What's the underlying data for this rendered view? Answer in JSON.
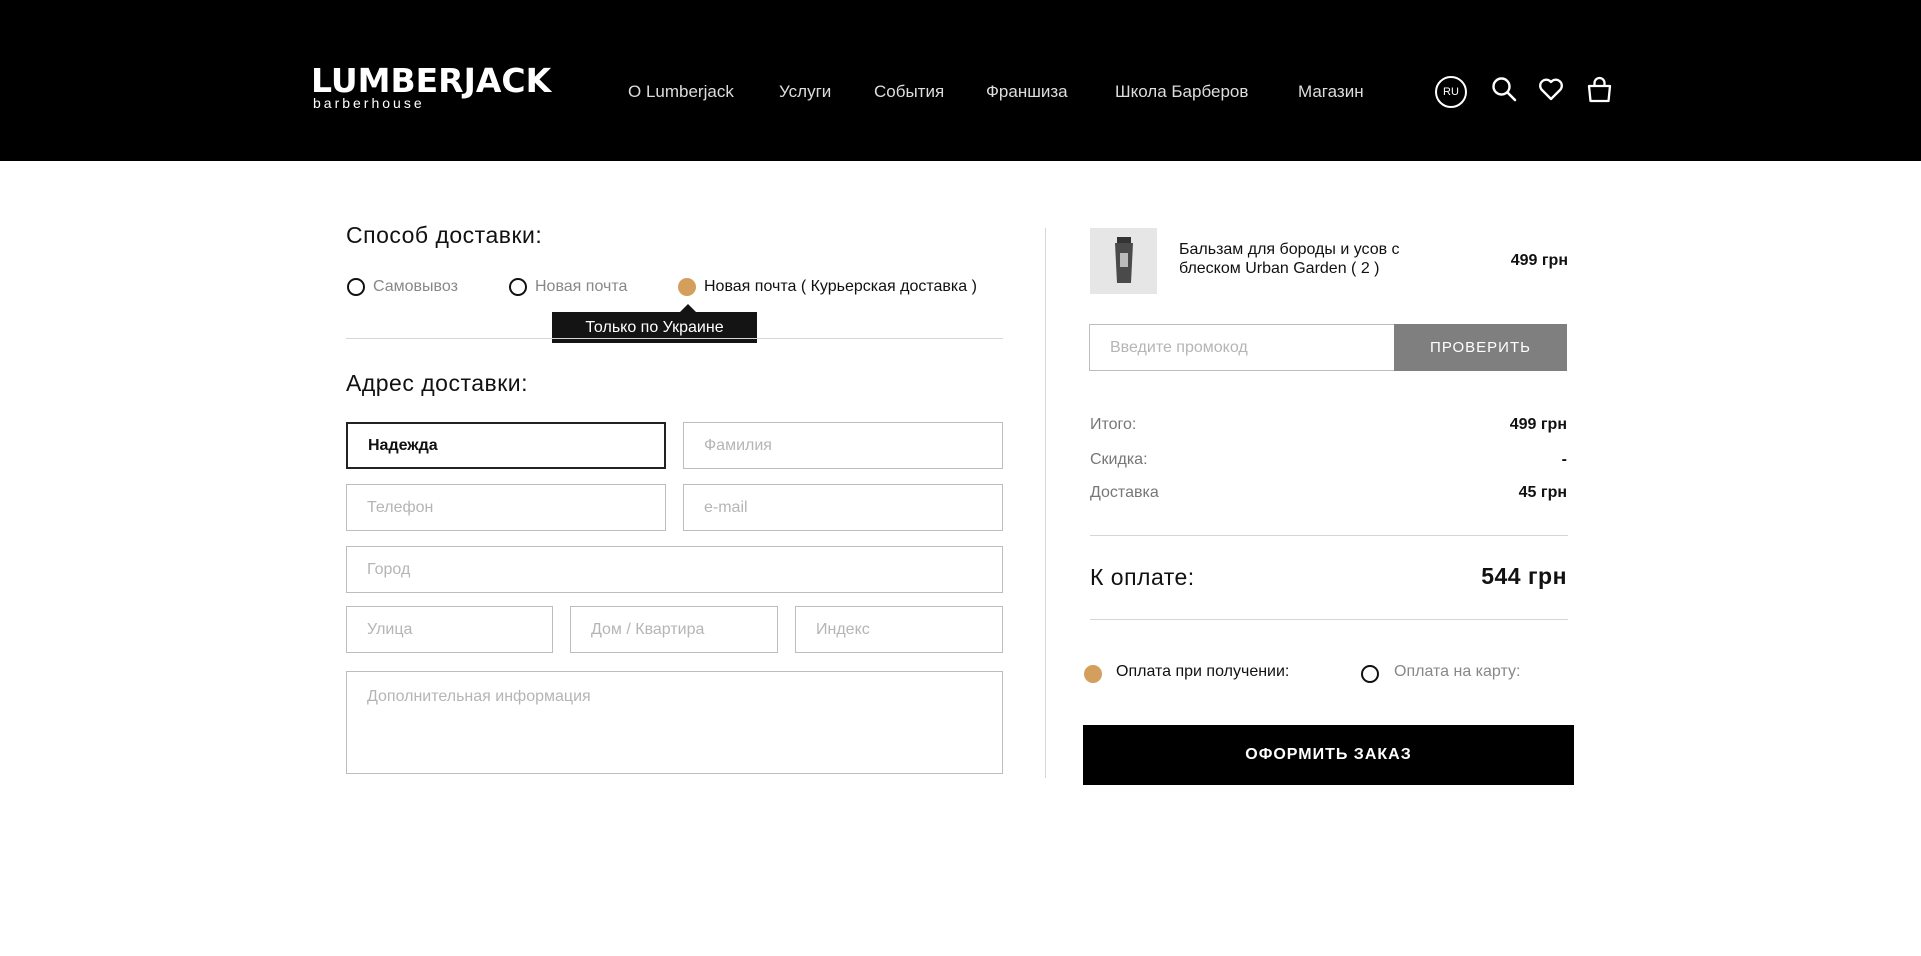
{
  "header": {
    "logo_main": "LUMBERJACK",
    "logo_sub": "barberhouse",
    "nav": [
      {
        "label": "О Lumberjack"
      },
      {
        "label": "Услуги"
      },
      {
        "label": "События"
      },
      {
        "label": "Франшиза"
      },
      {
        "label": "Школа Барберов"
      },
      {
        "label": "Магазин"
      }
    ],
    "lang": "RU",
    "icons": [
      "search-icon",
      "heart-icon",
      "cart-icon"
    ]
  },
  "delivery": {
    "title": "Способ доставки:",
    "options": [
      {
        "label": "Самовывоз",
        "selected": false
      },
      {
        "label": "Новая почта",
        "selected": false
      },
      {
        "label": "Новая почта ( Курьерская доставка )",
        "selected": true
      }
    ],
    "tooltip": "Только по Украине"
  },
  "address": {
    "title": "Адрес доставки:",
    "first_name": {
      "value": "Надежда",
      "placeholder": ""
    },
    "last_name": {
      "value": "",
      "placeholder": "Фамилия"
    },
    "phone": {
      "value": "",
      "placeholder": "Телефон"
    },
    "email": {
      "value": "",
      "placeholder": "e-mail"
    },
    "city": {
      "value": "",
      "placeholder": "Город"
    },
    "street": {
      "value": "",
      "placeholder": "Улица"
    },
    "house": {
      "value": "",
      "placeholder": "Дом / Квартира"
    },
    "zip": {
      "value": "",
      "placeholder": "Индекс"
    },
    "extra": {
      "value": "",
      "placeholder": "Дополнительная информация"
    }
  },
  "cart": {
    "product": {
      "name": "Бальзам для бороды и усов с блеском Urban Garden ( 2 )",
      "price": "499 грн"
    },
    "promo": {
      "placeholder": "Введите промокод",
      "button": "ПРОВЕРИТЬ"
    },
    "summary": [
      {
        "label": "Итого:",
        "value": "499 грн"
      },
      {
        "label": "Скидка:",
        "value": "-"
      },
      {
        "label": "Доставка",
        "value": "45 грн"
      }
    ],
    "total_label": "К оплате:",
    "total_value": "544 грн",
    "payment": [
      {
        "label": "Оплата при получении:",
        "selected": true
      },
      {
        "label": "Оплата на карту:",
        "selected": false
      }
    ],
    "submit": "ОФОРМИТЬ ЗАКАЗ"
  },
  "colors": {
    "accent": "#d49e5c",
    "header_bg": "#000000",
    "promo_button": "#7f7f7f"
  }
}
